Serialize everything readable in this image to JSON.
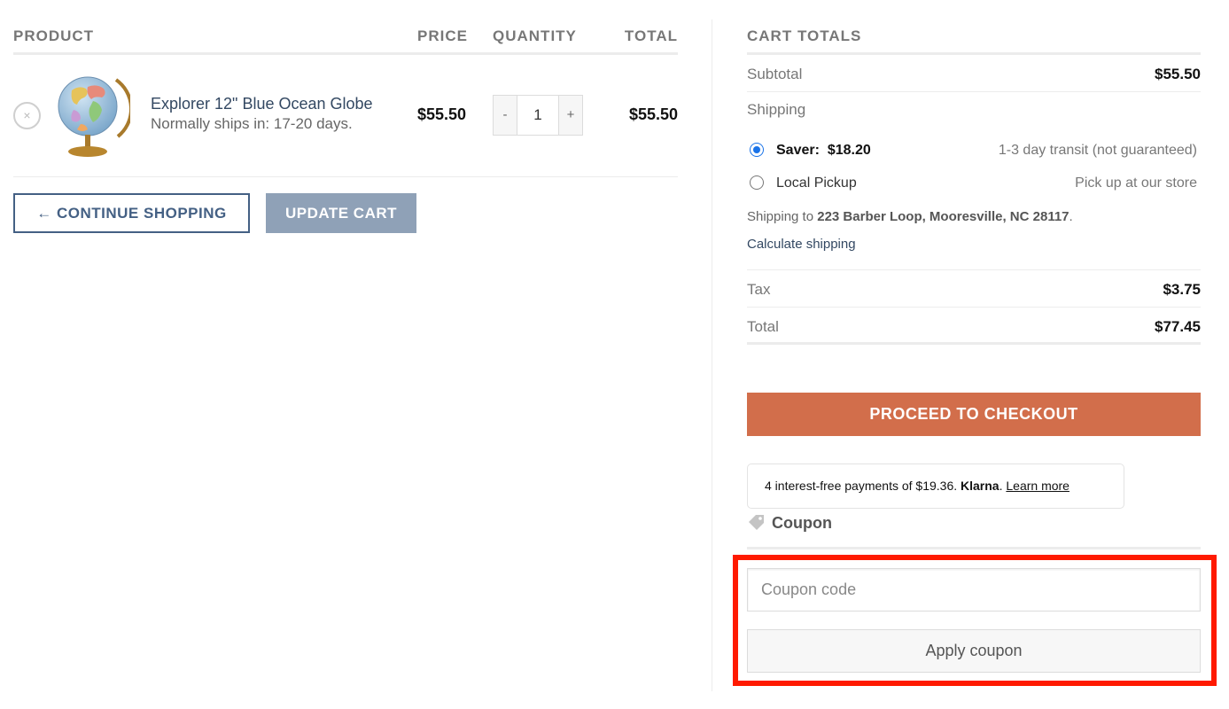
{
  "cart": {
    "headers": {
      "product": "Product",
      "price": "Price",
      "quantity": "Quantity",
      "total": "Total"
    },
    "items": [
      {
        "remove_symbol": "×",
        "name": "Explorer 12\" Blue Ocean Globe",
        "ships": "Normally ships in: 17-20 days.",
        "price": "$55.50",
        "qty_minus": "-",
        "qty_value": "1",
        "qty_plus": "+",
        "total": "$55.50",
        "thumb_icon": "globe-icon"
      }
    ],
    "continue_label": "← Continue Shopping",
    "update_label": "Update Cart"
  },
  "totals": {
    "title": "Cart Totals",
    "subtotal_label": "Subtotal",
    "subtotal_value": "$55.50",
    "shipping_label": "Shipping",
    "shipping_options": [
      {
        "name": "Saver:",
        "price": "$18.20",
        "desc": "1-3 day transit (not guaranteed)",
        "selected": true
      },
      {
        "name": "Local Pickup",
        "price": "",
        "desc": "Pick up at our store",
        "selected": false
      }
    ],
    "ship_to_prefix": "Shipping to",
    "ship_to_address": "223 Barber Loop, Mooresville, NC 28117",
    "ship_to_suffix": ".",
    "calculate_label": "Calculate shipping",
    "tax_label": "Tax",
    "tax_value": "$3.75",
    "total_label": "Total",
    "total_value": "$77.45",
    "checkout_label": "Proceed to checkout"
  },
  "klarna": {
    "text": "4 interest-free payments of $19.36.",
    "brand": "Klarna",
    "dot": ".",
    "link": "Learn more"
  },
  "coupon": {
    "title": "Coupon",
    "icon": "tag-icon",
    "placeholder": "Coupon code",
    "apply_label": "Apply coupon"
  },
  "colors": {
    "accent_primary": "#446084",
    "link": "#334862",
    "checkout": "#d26e4b",
    "update_button": "#8fa1b7",
    "highlight": "#ff1a00",
    "radio_selected": "#1a73e8"
  }
}
